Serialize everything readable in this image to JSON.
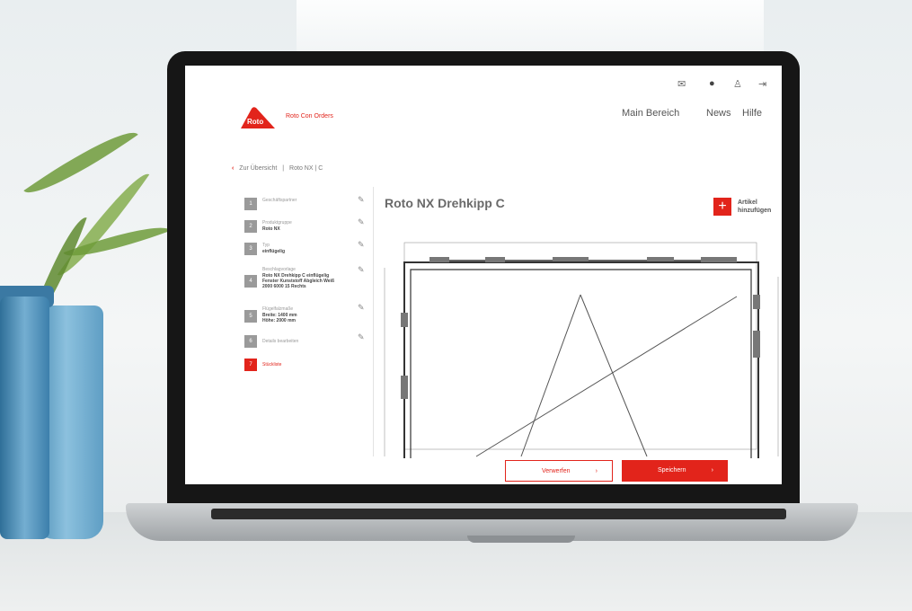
{
  "header": {
    "icons": [
      "mail-icon",
      "globe-icon",
      "user-icon",
      "logout-icon"
    ],
    "logo_text": "Roto",
    "brand": "Roto Con Orders",
    "nav": [
      "Main Bereich",
      "News",
      "Hilfe"
    ]
  },
  "breadcrumb": {
    "back": "Zur Übersicht",
    "separator": "|",
    "current": "Roto NX | C"
  },
  "steps": [
    {
      "num": "1",
      "label": "Geschäftspartner",
      "value": ""
    },
    {
      "num": "2",
      "label": "Produktgruppe",
      "value": "Roto NX"
    },
    {
      "num": "3",
      "label": "Typ",
      "value": "einflügelig"
    },
    {
      "num": "4",
      "label": "Beschlagvorlage",
      "value": "Roto NX Drehkipp C einflügelig\nFenster Kunststoff Abgleich Weiß\n2000 6000 15 Rechts"
    },
    {
      "num": "5",
      "label": "Flügelfalzmaße",
      "value": "Breite: 1400 mm\nHöhe: 2000 mm"
    },
    {
      "num": "6",
      "label": "Details bearbeiten",
      "value": ""
    },
    {
      "num": "7",
      "label": "Stückliste",
      "value": ""
    }
  ],
  "main": {
    "title": "Roto NX Drehkipp C",
    "add_label": "Artikel\nhinzufügen"
  },
  "footer": {
    "discard": "Verwerfen",
    "save": "Speichern"
  },
  "colors": {
    "accent": "#e2241b"
  }
}
